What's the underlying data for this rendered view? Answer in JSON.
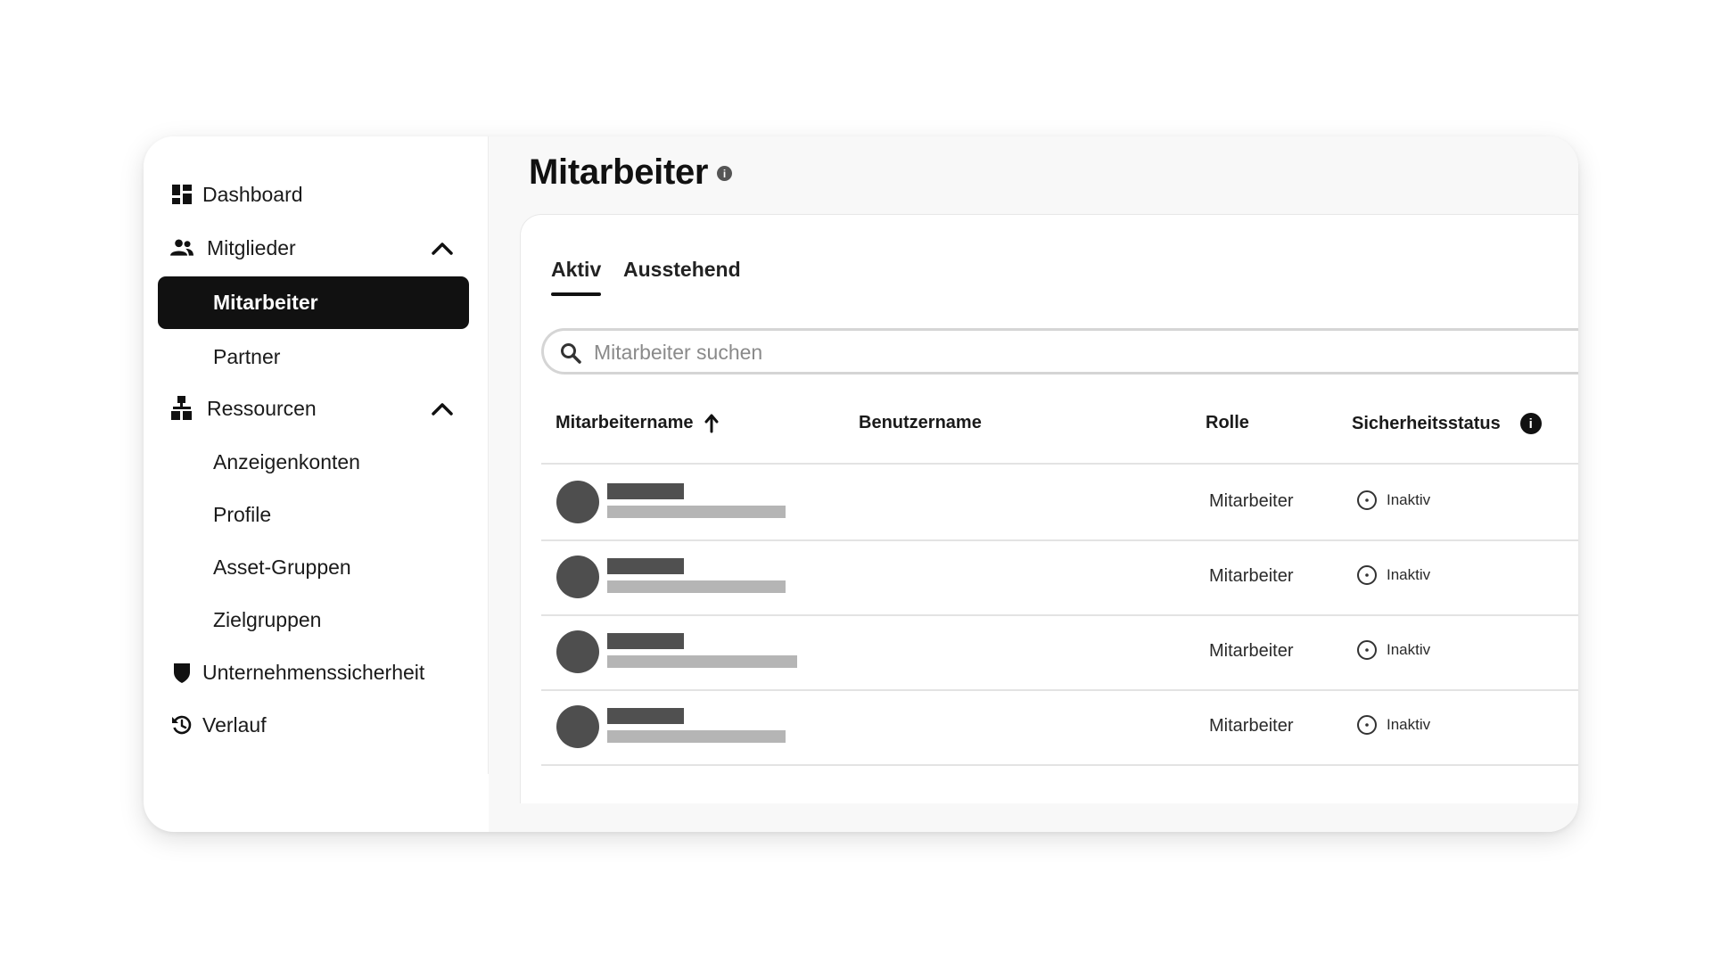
{
  "sidebar": {
    "items": [
      {
        "label": "Dashboard",
        "icon": "dashboard-icon"
      },
      {
        "label": "Mitglieder",
        "icon": "people-icon",
        "expanded": true,
        "children": [
          {
            "label": "Mitarbeiter",
            "active": true
          },
          {
            "label": "Partner"
          }
        ]
      },
      {
        "label": "Ressourcen",
        "icon": "resources-icon",
        "expanded": true,
        "children": [
          {
            "label": "Anzeigenkonten"
          },
          {
            "label": "Profile"
          },
          {
            "label": "Asset-Gruppen"
          },
          {
            "label": "Zielgruppen"
          }
        ]
      },
      {
        "label": "Unternehmenssicherheit",
        "icon": "shield-icon"
      },
      {
        "label": "Verlauf",
        "icon": "history-icon"
      }
    ]
  },
  "header": {
    "title": "Mitarbeiter",
    "info_icon": "info-icon"
  },
  "tabs": [
    {
      "label": "Aktiv",
      "active": true
    },
    {
      "label": "Ausstehend",
      "active": false
    }
  ],
  "search": {
    "placeholder": "Mitarbeiter suchen",
    "value": ""
  },
  "table": {
    "columns": [
      {
        "label": "Mitarbeitername",
        "sort": "ascending"
      },
      {
        "label": "Benutzername"
      },
      {
        "label": "Rolle"
      },
      {
        "label": "Sicherheitsstatus",
        "info_icon": "info-icon"
      }
    ],
    "rows": [
      {
        "role": "Mitarbeiter",
        "status": "Inaktiv"
      },
      {
        "role": "Mitarbeiter",
        "status": "Inaktiv"
      },
      {
        "role": "Mitarbeiter",
        "status": "Inaktiv"
      },
      {
        "role": "Mitarbeiter",
        "status": "Inaktiv"
      }
    ]
  },
  "colors": {
    "active_nav_bg": "#111111",
    "avatar": "#4e4e4e",
    "placeholder_name": "#505050",
    "placeholder_username": "#b5b5b5"
  }
}
